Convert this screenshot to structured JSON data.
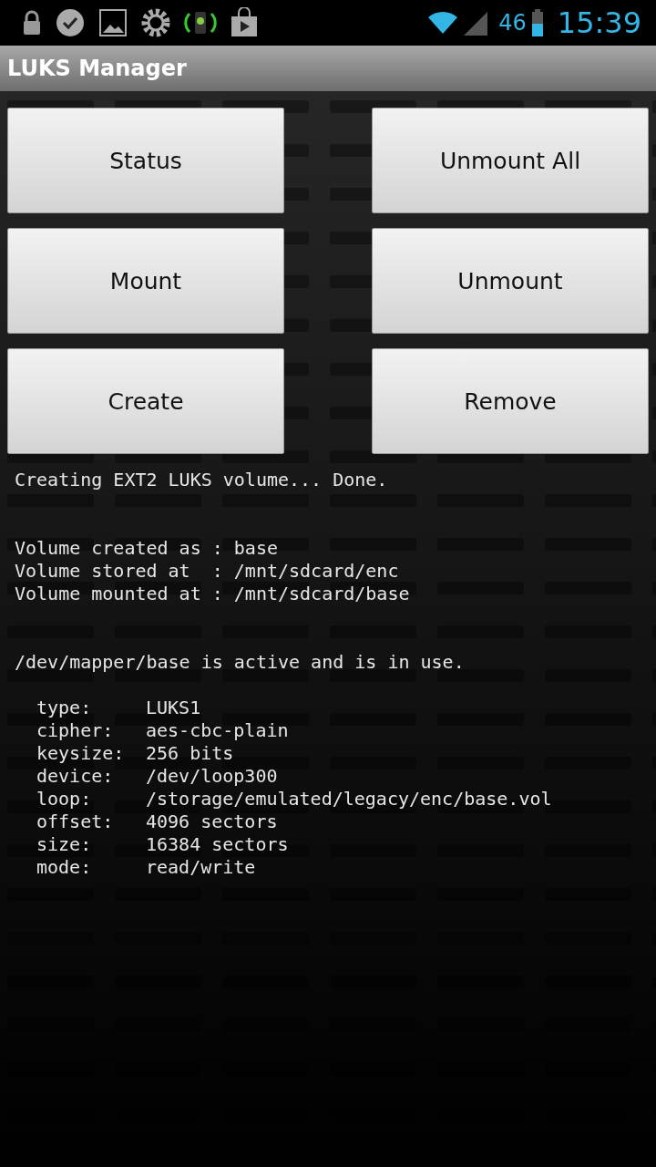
{
  "status_bar": {
    "battery_percent": "46",
    "time": "15:39"
  },
  "title_bar": {
    "title": "LUKS Manager"
  },
  "buttons": [
    {
      "label": "Status"
    },
    {
      "label": "Unmount All"
    },
    {
      "label": "Mount"
    },
    {
      "label": "Unmount"
    },
    {
      "label": "Create"
    },
    {
      "label": "Remove"
    }
  ],
  "log": {
    "blocks": [
      {
        "lines": [
          "Creating EXT2 LUKS volume... Done."
        ]
      },
      {
        "lines": [
          "Volume created as : base",
          "Volume stored at  : /mnt/sdcard/enc",
          "Volume mounted at : /mnt/sdcard/base"
        ]
      },
      {
        "lines": [
          "/dev/mapper/base is active and is in use."
        ],
        "fields": [
          {
            "label": "type:",
            "value": "LUKS1"
          },
          {
            "label": "cipher:",
            "value": "aes-cbc-plain"
          },
          {
            "label": "keysize:",
            "value": "256 bits"
          },
          {
            "label": "device:",
            "value": "/dev/loop300"
          },
          {
            "label": "loop:",
            "value": "/storage/emulated/legacy/enc/base.vol"
          },
          {
            "label": "offset:",
            "value": "4096 sectors"
          },
          {
            "label": "size:",
            "value": "16384 sectors"
          },
          {
            "label": "mode:",
            "value": "read/write"
          }
        ]
      }
    ]
  }
}
